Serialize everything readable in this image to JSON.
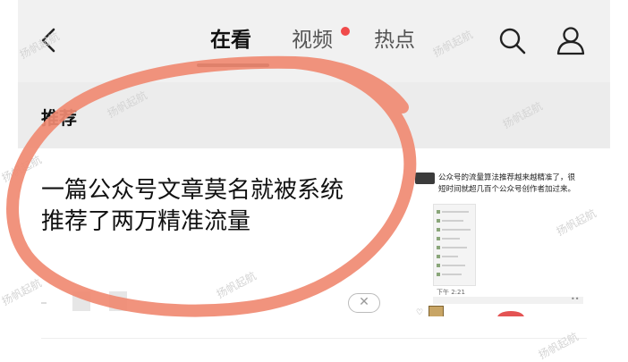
{
  "header": {
    "tabs": [
      {
        "label": "在看",
        "active": true
      },
      {
        "label": "视频",
        "active": false,
        "badge": "red-dot"
      },
      {
        "label": "热点",
        "active": false
      }
    ],
    "icons": {
      "back": "chevron-left-icon",
      "search": "search-icon",
      "profile": "user-icon"
    }
  },
  "section": {
    "label": "推荐"
  },
  "article": {
    "title_line1": "一篇公众号文章莫名就被系统",
    "title_line2": "推荐了两万精准流量",
    "close_glyph": "✕"
  },
  "thumbnail": {
    "caption_line1": "公众号的流量算法推荐越来越精准了，很",
    "caption_line2": "短时间就超几百个公众号创作者加过来。",
    "time": "下午 2:21"
  },
  "overlay": {
    "circle_color": "#f08a72"
  },
  "watermark": {
    "text": "扬帆起航"
  },
  "colors": {
    "accent_red": "#f04a4a",
    "header_bg": "#f1f1f1",
    "section_bg": "#ececec"
  }
}
